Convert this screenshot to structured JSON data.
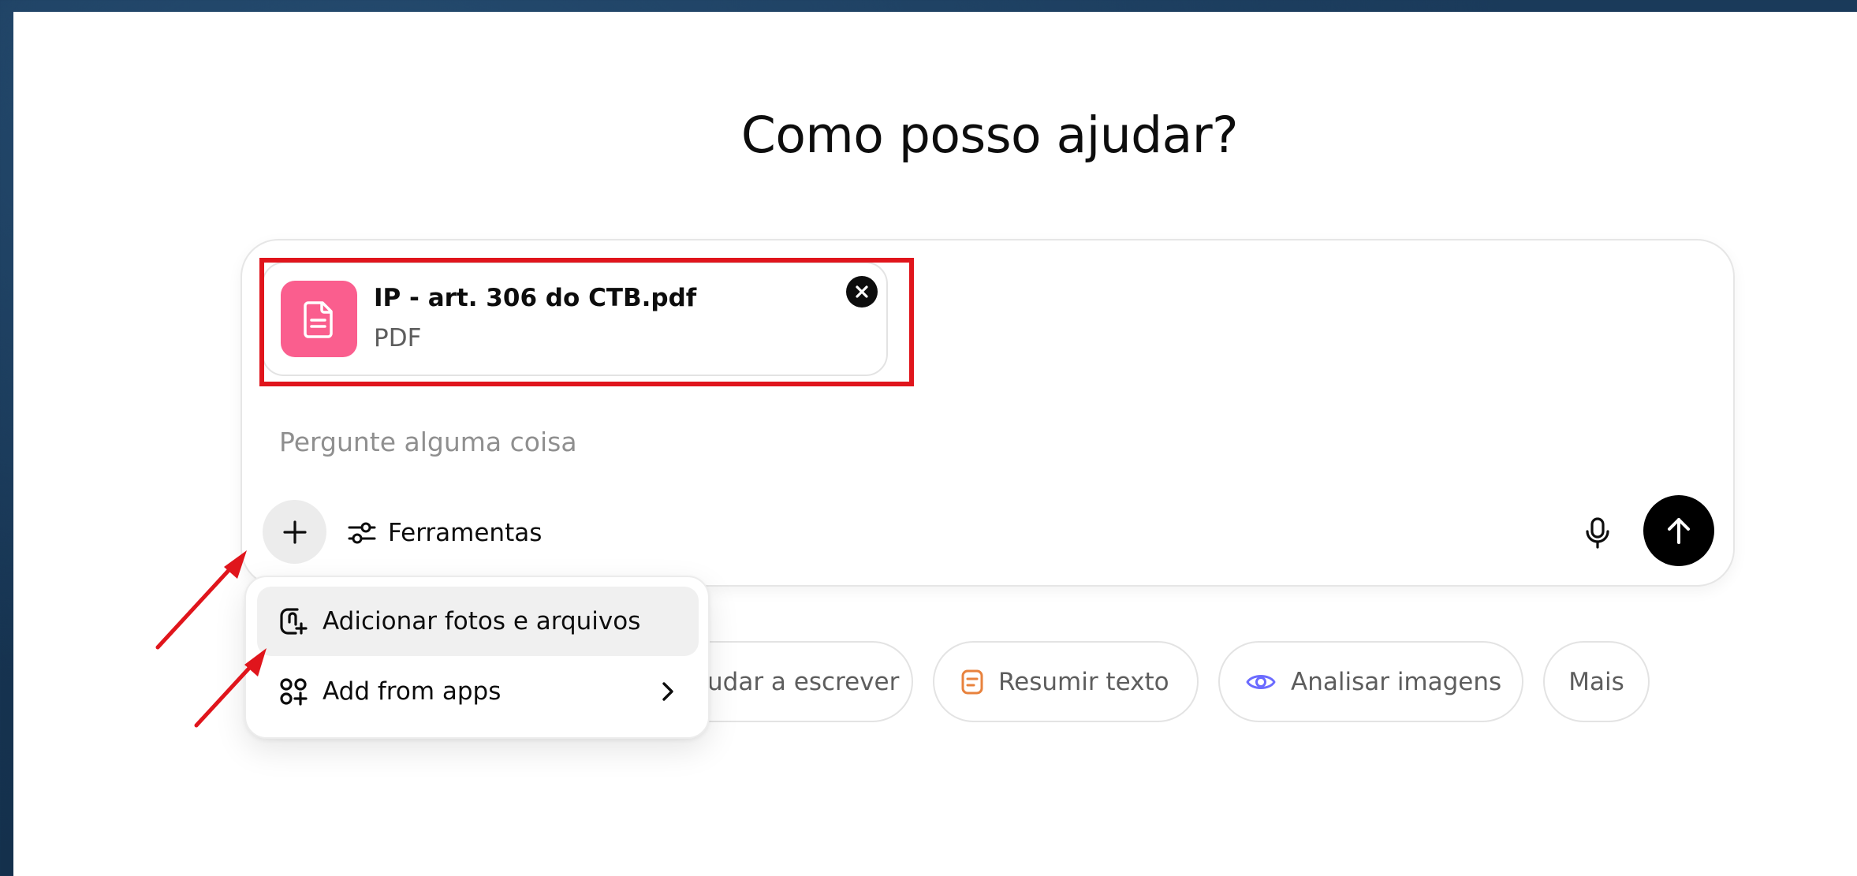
{
  "heading": "Como posso ajudar?",
  "attachment": {
    "file_name": "IP - art. 306 do CTB.pdf",
    "file_type": "PDF",
    "icon": "document-icon",
    "remove_icon": "close-icon"
  },
  "composer": {
    "placeholder": "Pergunte alguma coisa",
    "value": "",
    "plus_icon": "plus-icon",
    "tools_label": "Ferramentas",
    "tools_icon": "sliders-icon",
    "mic_icon": "microphone-icon",
    "send_icon": "arrow-up-icon"
  },
  "attach_menu": {
    "items": [
      {
        "label": "Adicionar fotos e arquivos",
        "icon": "paperclip-add-icon",
        "highlighted": true
      },
      {
        "label": "Add from apps",
        "icon": "apps-add-icon",
        "has_submenu": true
      }
    ]
  },
  "suggestions": [
    {
      "label": "Ajudar a escrever",
      "visible_text": "udar a escrever",
      "icon": "pen-icon"
    },
    {
      "label": "Resumir texto",
      "icon": "document-icon",
      "icon_color": "#e8823d"
    },
    {
      "label": "Analisar imagens",
      "icon": "eye-icon",
      "icon_color": "#6b6bff"
    },
    {
      "label": "Mais"
    }
  ],
  "annotations": {
    "highlight_color": "#e0151c",
    "arrow_color": "#e0151c"
  },
  "colors": {
    "file_icon_bg": "#fa5e8e",
    "send_button_bg": "#000000",
    "plus_button_bg": "#ececec",
    "desktop_bg": "#16324f"
  }
}
